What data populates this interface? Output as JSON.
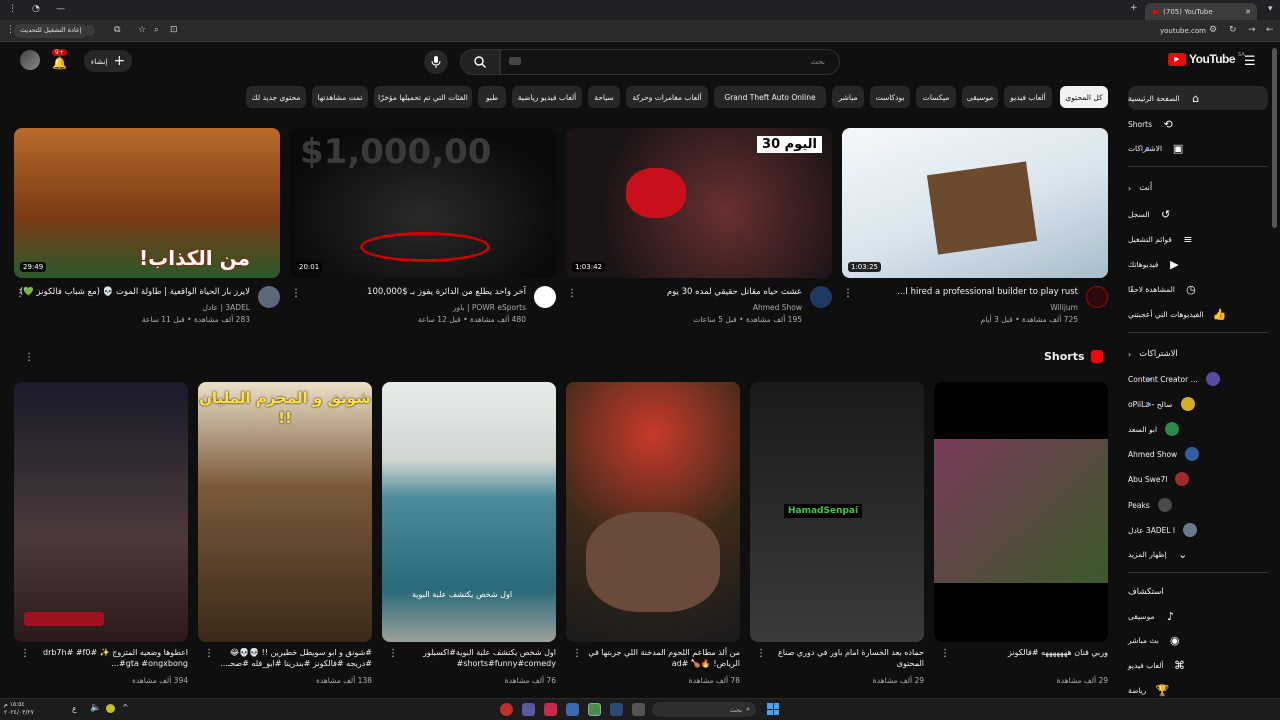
{
  "browser": {
    "tab_title": "(705) YouTube",
    "url": "youtube.com",
    "reload_tooltip": "إعادة التشغيل للتحديث"
  },
  "header": {
    "logo": "YouTube",
    "logo_region": "SA",
    "search_placeholder": "بحث",
    "create_label": "إنشاء",
    "notif_count": "9+"
  },
  "chips": [
    {
      "label": "كل المحتوى",
      "active": true
    },
    {
      "label": "ألعاب فيديو"
    },
    {
      "label": "موسيقى"
    },
    {
      "label": "ميكسات"
    },
    {
      "label": "بودكاست"
    },
    {
      "label": "مباشر"
    },
    {
      "label": "Grand Theft Auto Online"
    },
    {
      "label": "ألعاب مغامرات وحركة"
    },
    {
      "label": "سياحة"
    },
    {
      "label": "ألعاب فيديو رياضية"
    },
    {
      "label": "طبو"
    },
    {
      "label": "الفئات التي تم تحميلها مؤخرًا"
    },
    {
      "label": "تمت مشاهدتها"
    },
    {
      "label": "محتوى جديد لك"
    }
  ],
  "videos": [
    {
      "title": "I hired a professional builder to play rust...",
      "channel": "Willjum",
      "meta": "725 ألف مشاهدة • قبل 3 أيام",
      "duration": "1:03:25",
      "color": "#dfe8ee"
    },
    {
      "title": "عشت حياه مقاتل حقيقي لمده 30 يوم",
      "channel": "Ahmed Show",
      "meta": "195 ألف مشاهدة • قبل 5 ساعات",
      "duration": "1:03:42",
      "thumb_text": "اليوم 30",
      "color": "#3a2a2a"
    },
    {
      "title": "آخر واحد يطلع من الدائرة يفوز بـ $100,000",
      "channel": "POWR eSports | باور",
      "meta": "480 ألف مشاهدة • قبل 12 ساعة",
      "duration": "20:01",
      "thumb_text": "$1,000,00",
      "color": "#1c1c1c"
    },
    {
      "title": "لايرز بار الحياة الواقعية | طاولة الموت 💀 (مع شباب فالكونز 💚)",
      "channel": "3ADEL | عادل",
      "meta": "283 ألف مشاهدة • قبل 11 ساعة",
      "duration": "29:49",
      "thumb_text": "من الكذاب!",
      "color": "#8a4a1e"
    }
  ],
  "shorts_section": {
    "title": "Shorts",
    "items": [
      {
        "title": "وربي فنان هههههههه #فالكونز",
        "views": "29 ألف مشاهدة",
        "color": "#6a2a4a"
      },
      {
        "title": "حماده بعد الخسارة امام باور في دوري صناع المحتوى",
        "views": "29 ألف مشاهدة",
        "overlay": "HamadSenpai",
        "color": "#2a2a2a"
      },
      {
        "title": "من ألذ مطاعم اللحوم المدخنة اللي جربتها في الرياض! 🔥🍗 #ad",
        "views": "78 ألف مشاهدة",
        "color": "#5a3a2a"
      },
      {
        "title": "اول شخص يكتشف علبة البوية#اكسبلور shorts#funny#comedy#",
        "views": "76 ألف مشاهدة",
        "overlay": "اول شخص يكتشف علبة البوية",
        "color": "#5a7a8a"
      },
      {
        "title": "#شونق و ابو سويطل خطيرين !! 💀💀😂 #دريجه #فالكونز #بندريتا #ابو_فله #ضحـ...",
        "views": "138 ألف مشاهدة",
        "overlay": "شونق و المحزم المليان !!",
        "color": "#4a3a2a"
      },
      {
        "title": "اعطوها وضعيه المتزوج ✨ #drb7h# #f0 #gta #ongxbong...",
        "views": "394 ألف مشاهدة",
        "color": "#2a2a3a"
      }
    ]
  },
  "sidebar": {
    "main": [
      {
        "label": "الصفحة الرئيسية",
        "icon": "home-icon"
      },
      {
        "label": "Shorts",
        "icon": "shorts-icon"
      },
      {
        "label": "الاشتراكات",
        "icon": "subscriptions-icon"
      }
    ],
    "you_heading": "أنت",
    "you": [
      {
        "label": "السجل",
        "icon": "history-icon"
      },
      {
        "label": "قوائم التشغيل",
        "icon": "playlists-icon"
      },
      {
        "label": "فيديوهاتك",
        "icon": "your-videos-icon"
      },
      {
        "label": "المشاهدة لاحقًا",
        "icon": "watch-later-icon"
      },
      {
        "label": "الفيديوهات التي أعجبتني",
        "icon": "liked-icon"
      }
    ],
    "subs_heading": "الاشتراكات",
    "subs": [
      {
        "label": "Content Creator ...",
        "color": "#5a4aa0"
      },
      {
        "label": "صالح - oPiiLz",
        "color": "#d0b020"
      },
      {
        "label": "ابو السعد",
        "color": "#2a8a4a"
      },
      {
        "label": "Ahmed Show",
        "color": "#3060a0"
      },
      {
        "label": "Abu Swe7l",
        "color": "#a02a2a"
      },
      {
        "label": "Peaks",
        "color": "#4a4a4a"
      },
      {
        "label": "3ADEL l عادل",
        "color": "#6a7a8a"
      }
    ],
    "show_more": "إظهار المزيد",
    "explore_heading": "استكشاف",
    "explore": [
      {
        "label": "موسيقى",
        "icon": "music-icon"
      },
      {
        "label": "بث مباشر",
        "icon": "live-icon"
      },
      {
        "label": "ألعاب فيديو",
        "icon": "gaming-icon"
      },
      {
        "label": "رياضة",
        "icon": "sports-icon"
      }
    ]
  },
  "taskbar": {
    "search_placeholder": "بحث",
    "clock": "١٥:٥٤ م",
    "date": "٢٠٢٤/٠٣/٢٧",
    "lang": "ع"
  }
}
